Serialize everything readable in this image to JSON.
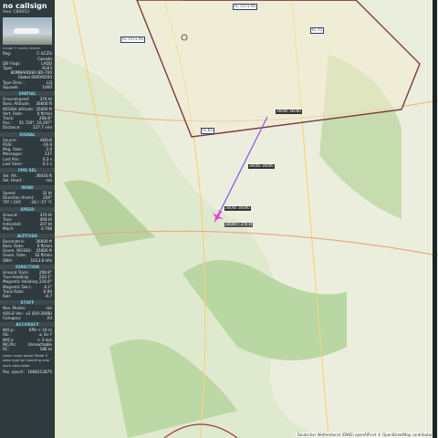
{
  "sidebar": {
    "callsign": "no callsign",
    "hex": "Hex: C84053",
    "photo_credit": "Image © Ashley Woods",
    "info": [
      {
        "k": "Reg:",
        "v": "C-GCZG"
      },
      {
        "k": "",
        "v": "Canada"
      },
      {
        "k": "DB Flags:",
        "v": "LADD"
      },
      {
        "k": "Type:",
        "v": "GL63"
      },
      {
        "k": "",
        "v": "BOMBARDIER BD-700 Global 6000/6500"
      },
      {
        "k": "Type Desc.:",
        "v": "L2J"
      },
      {
        "k": "Squawk:",
        "v": "1000"
      }
    ],
    "sections": [
      {
        "title": "SPATIAL",
        "rows": [
          {
            "k": "Groundspeed:",
            "v": "376 kt"
          },
          {
            "k": "Baro. Altitude:",
            "v": "36000 ft"
          },
          {
            "k": "WGS84 altitude:",
            "v": "35400 ft"
          },
          {
            "k": "Vert. Rate:",
            "v": "0 ft/min"
          },
          {
            "k": "Track:",
            "v": "208.8°"
          },
          {
            "k": "Pos.:",
            "v": "51.726°, 10.297°"
          },
          {
            "k": "Distance:",
            "v": "127.7 nmi"
          }
        ]
      },
      {
        "title": "SIGNAL",
        "rows": [
          {
            "k": "Source:",
            "v": "ADS-B"
          },
          {
            "k": "RSSI:",
            "v": "-16.9"
          },
          {
            "k": "Msg. Rate:",
            "v": "2.0"
          },
          {
            "k": "Messages:",
            "v": "137"
          },
          {
            "k": "Last Pos.:",
            "v": "0.3 s"
          },
          {
            "k": "Last Seen:",
            "v": "0.1 s"
          }
        ]
      },
      {
        "title": "FMS SEL",
        "rows": [
          {
            "k": "Sel. Alt.:",
            "v": "36016 ft"
          },
          {
            "k": "Sel. Head.:",
            "v": "n/a"
          }
        ]
      },
      {
        "title": "WIND",
        "rows": [
          {
            "k": "Speed:",
            "v": "32 kt"
          },
          {
            "k": "Direction (from):",
            "v": "354°"
          },
          {
            "k": "TAT / OAT:",
            "v": "-34 / -57 °C"
          }
        ]
      },
      {
        "title": "SPEED",
        "rows": [
          {
            "k": "Ground:",
            "v": "376 kt"
          },
          {
            "k": "True:",
            "v": "408 kt"
          },
          {
            "k": "Indicated:",
            "v": "247 kt"
          },
          {
            "k": "Mach:",
            "v": "0.708"
          }
        ]
      },
      {
        "title": "ALTITUDE",
        "rows": [
          {
            "k": "Barometric:",
            "v": "36000 ft"
          },
          {
            "k": "Baro. Rate:",
            "v": "0 ft/min"
          },
          {
            "k": "Geom. WGS84:",
            "v": "35400 ft"
          },
          {
            "k": "Geom. Rate:",
            "v": "32 ft/min"
          },
          {
            "k": "QNH:",
            "v": "1013.6 hPa"
          }
        ]
      },
      {
        "title": "DIRECTION",
        "rows": [
          {
            "k": "Ground Track:",
            "v": "208.8°"
          },
          {
            "k": "True Heading:",
            "v": "220.1°"
          },
          {
            "k": "Magnetic Heading:",
            "v": "216.6°"
          },
          {
            "k": "Magnetic Decl.:",
            "v": "4.2°"
          },
          {
            "k": "Track Rate:",
            "v": "0.00"
          },
          {
            "k": "Roll:",
            "v": "-0.7"
          }
        ]
      },
      {
        "title": "STUFF",
        "rows": [
          {
            "k": "Nav. Modes:",
            "v": "n/a"
          },
          {
            "k": "ADS-B Ver.:",
            "v": "v2 (DO-260B)"
          },
          {
            "k": "Category:",
            "v": "A3"
          }
        ]
      },
      {
        "title": "ACCURACY",
        "rows": [
          {
            "k": "NACp:",
            "v": "EPU < 10 m"
          },
          {
            "k": "SIL:",
            "v": "≤ 1e-7"
          },
          {
            "k": "NACv:",
            "v": "< 3 m/s"
          },
          {
            "k": "NIC/Rc:",
            "v": "Unreachable"
          },
          {
            "k": "RC:",
            "v": "186 m"
          }
        ]
      }
    ],
    "footer_note": "Learn more about Mode S data type by hovering over each data label.",
    "epoch": {
      "k": "Pos. epoch:",
      "v": "1666212875"
    }
  },
  "map": {
    "attribution": "Deutscher Wetterdienst (DWD) openAIP.net © OpenStreetMap contributors",
    "aircraft_tag": "36000 / 376 kt",
    "trail_labels": [
      "36000 36000",
      "36000 36000",
      "36000 36000"
    ],
    "airspace_labels": [
      "FL 75 FL 95",
      "FL 75 FL 95",
      "FL 75",
      "FL 65"
    ]
  },
  "colors": {
    "sidebar_bg": "#2f3a3e",
    "section": "#7fd3e6",
    "track": "#8a4fff",
    "aircraft": "#e23be8"
  }
}
